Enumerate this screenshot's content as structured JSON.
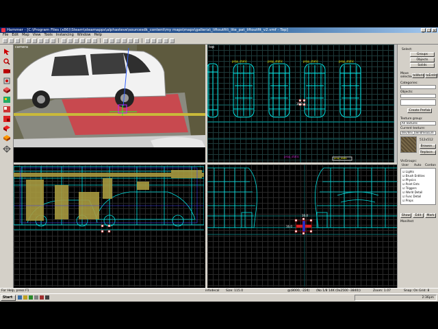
{
  "window": {
    "title": "Hammer - [C:\\Program Files (x86)\\Steam\\steamapps\\alphasteve\\sourcesdk_content\\my maps\\maps\\galleria\\_liftoutfit\\_lite_pat_liftoutfit_v2.vmf - Top]",
    "controls": [
      "_",
      "□",
      "×"
    ]
  },
  "menu": [
    "File",
    "Edit",
    "Map",
    "View",
    "Tools",
    "Instancing",
    "Window",
    "Help"
  ],
  "viewports": {
    "camera_label": "camera",
    "top_label": "top",
    "entity_labels": [
      "prop_static",
      "prop_static",
      "prop_static",
      "prop_static"
    ],
    "top_magenta_label": "prop_static",
    "top_bottom_label": "prop_static"
  },
  "right_panel": {
    "select_label": "Select:",
    "groups_button": "Groups",
    "objects_button": "Objects",
    "solids_button": "Solids",
    "move_selected_label": "Move selected:",
    "to_world_button": "toWorld",
    "to_entity_button": "toEntity",
    "categories_label": "Categories:",
    "objects_label": "Objects:",
    "create_prefab_button": "Create Prefab",
    "texture_group_label": "Texture group:",
    "texture_group_value": "All Textures",
    "current_texture_label": "Current texture:",
    "current_texture_value": "dev/dev_blendmeasure",
    "texture_size": "512x512",
    "browse_button": "Browse...",
    "replace_button": "Replace...",
    "visgroups_label": "VisGroups:",
    "visgroup_tabs": [
      "User",
      "Auto",
      "Cordon"
    ],
    "visgroup_items": [
      "Lights",
      "Brush Entities",
      "Physics",
      "Point Ents",
      "Triggers",
      "World Detail",
      "Func Detail",
      "Props"
    ],
    "show_button": "Show",
    "edit_button": "Edit",
    "mark_button": "Mark",
    "manifest_label": "Manifest"
  },
  "status": {
    "help": "For Help, press F1",
    "selection": "infodecal",
    "size": "Size: 115.0",
    "coords": "@(8000, -224)",
    "dims": "(No 1/8 14K (0x2500 -3840))",
    "zoom": "Zoom: 1.07",
    "snap": "Snap: On Grid: 8"
  },
  "taskbar": {
    "start": "Start",
    "clock": "2:36pm"
  },
  "colors": {
    "wireframe": "#00e5e5",
    "selection": "#ff2a2a",
    "titlebar": "#0a246a",
    "chrome": "#d4d0c8"
  }
}
